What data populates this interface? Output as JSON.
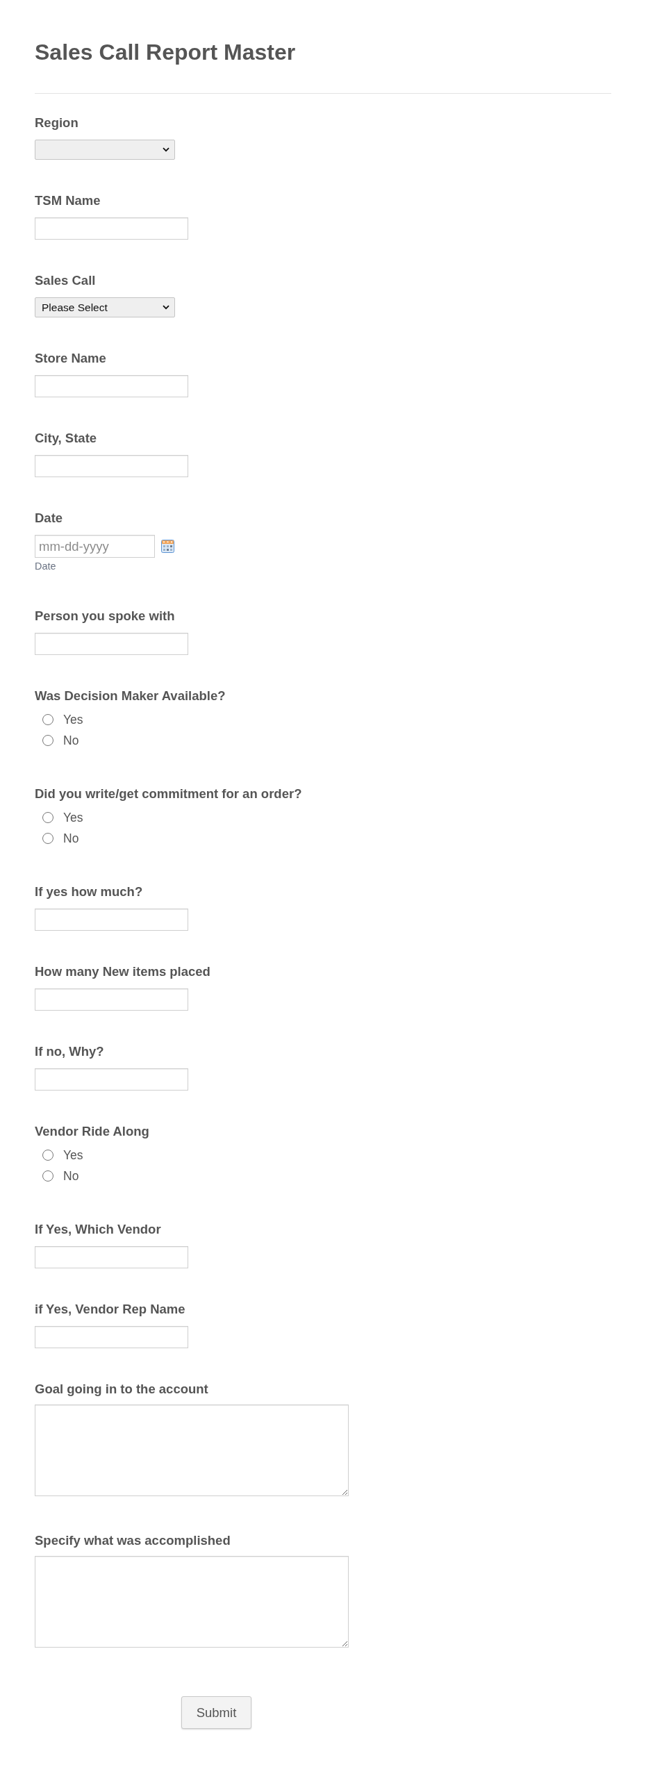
{
  "form": {
    "title": "Sales Call Report Master",
    "fields": [
      {
        "kind": "dropdown",
        "label": "Region"
      },
      {
        "kind": "textbox",
        "label": "TSM Name"
      },
      {
        "kind": "dropdown",
        "label": "Sales Call",
        "value": "Please Select"
      },
      {
        "kind": "textbox",
        "label": "Store Name"
      },
      {
        "kind": "textbox",
        "label": "City, State"
      },
      {
        "kind": "date",
        "label": "Date",
        "placeholder": "mm-dd-yyyy",
        "sublabel": "Date"
      },
      {
        "kind": "textbox",
        "label": "Person you spoke with"
      },
      {
        "kind": "radio",
        "label": "Was Decision Maker Available?",
        "options": [
          {
            "label": "Yes",
            "selected": false
          },
          {
            "label": "No",
            "selected": false
          }
        ]
      },
      {
        "kind": "radio",
        "label": "Did you write/get commitment for an order?",
        "options": [
          {
            "label": "Yes",
            "selected": false
          },
          {
            "label": "No",
            "selected": false
          }
        ]
      },
      {
        "kind": "textbox",
        "label": "If yes how much?"
      },
      {
        "kind": "textbox",
        "label": "How many New items placed"
      },
      {
        "kind": "textbox",
        "label": "If no, Why?"
      },
      {
        "kind": "radio",
        "label": "Vendor Ride Along",
        "options": [
          {
            "label": "Yes",
            "selected": false
          },
          {
            "label": "No",
            "selected": false
          }
        ]
      },
      {
        "kind": "textbox",
        "label": "If Yes, Which Vendor"
      },
      {
        "kind": "textbox",
        "label": "if Yes, Vendor Rep Name"
      },
      {
        "kind": "textarea",
        "label": "Goal going in to the account"
      },
      {
        "kind": "textarea",
        "label": "Specify what was accomplished"
      }
    ],
    "submit_button": "Submit"
  }
}
